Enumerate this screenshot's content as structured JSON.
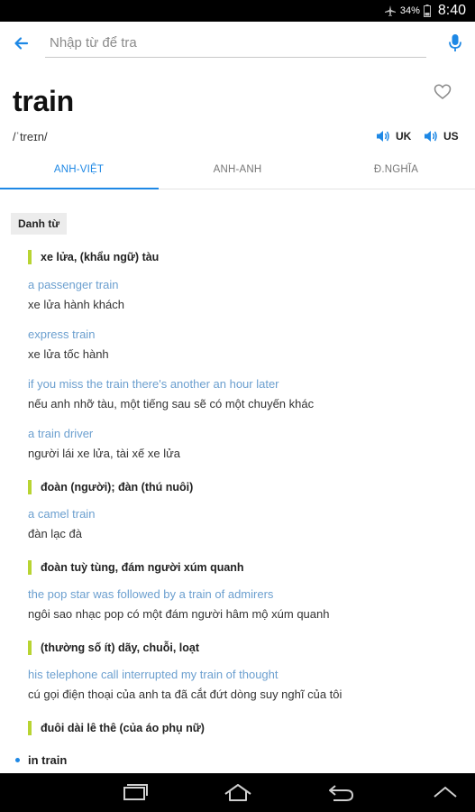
{
  "status_bar": {
    "battery_percent": "34%",
    "time": "8:40",
    "icons": [
      "airplane-mode-icon",
      "battery-icon"
    ]
  },
  "search": {
    "placeholder": "Nhập từ để tra",
    "value": "",
    "icons": [
      "back-arrow-icon",
      "microphone-icon"
    ]
  },
  "entry": {
    "word": "train",
    "phonetic": "/ˈtreɪn/",
    "favorite_icon": "heart-outline-icon",
    "pronunciations": [
      {
        "label": "UK",
        "icon": "speaker-icon"
      },
      {
        "label": "US",
        "icon": "speaker-icon"
      }
    ]
  },
  "tabs": [
    {
      "label": "ANH-VIỆT",
      "active": true
    },
    {
      "label": "ANH-ANH",
      "active": false
    },
    {
      "label": "Đ.NGHĨA",
      "active": false
    }
  ],
  "content": {
    "part_of_speech": "Danh từ",
    "senses": [
      {
        "meaning": "xe lửa, (khẩu ngữ) tàu",
        "examples": [
          {
            "en": "a passenger train",
            "vi": "xe lửa hành khách"
          },
          {
            "en": "express train",
            "vi": "xe lửa tốc hành"
          },
          {
            "en": "if you miss the train there's another an hour later",
            "vi": "nếu anh nhỡ tàu, một tiếng sau sẽ có một chuyến khác"
          },
          {
            "en": "a train driver",
            "vi": "người lái xe lửa, tài xế xe lửa"
          }
        ]
      },
      {
        "meaning": "đoàn (người); đàn (thú nuôi)",
        "examples": [
          {
            "en": "a camel train",
            "vi": "đàn lạc đà"
          }
        ]
      },
      {
        "meaning": "đoàn tuỳ tùng, đám người xúm quanh",
        "examples": [
          {
            "en": "the pop star was followed by a train of admirers",
            "vi": "ngôi sao nhạc pop có một đám người hâm mộ xúm quanh"
          }
        ]
      },
      {
        "meaning": "(thường số ít) dãy, chuỗi, loạt",
        "examples": [
          {
            "en": "his telephone call interrupted my train of thought",
            "vi": "cú gọi điện thoại của anh ta đã cắt đứt dòng suy nghĩ của tôi"
          }
        ]
      },
      {
        "meaning": "đuôi dài lê thê (của áo phụ nữ)",
        "examples": []
      }
    ],
    "idioms": [
      "in train"
    ]
  },
  "colors": {
    "accent": "#1e88e5",
    "sense_bar": "#b8d432",
    "example_text": "#6b9fcf",
    "tag_background": "#ececec"
  },
  "nav_bar": {
    "buttons": [
      "recent-apps-icon",
      "home-icon",
      "back-icon",
      "chevron-up-icon"
    ]
  }
}
